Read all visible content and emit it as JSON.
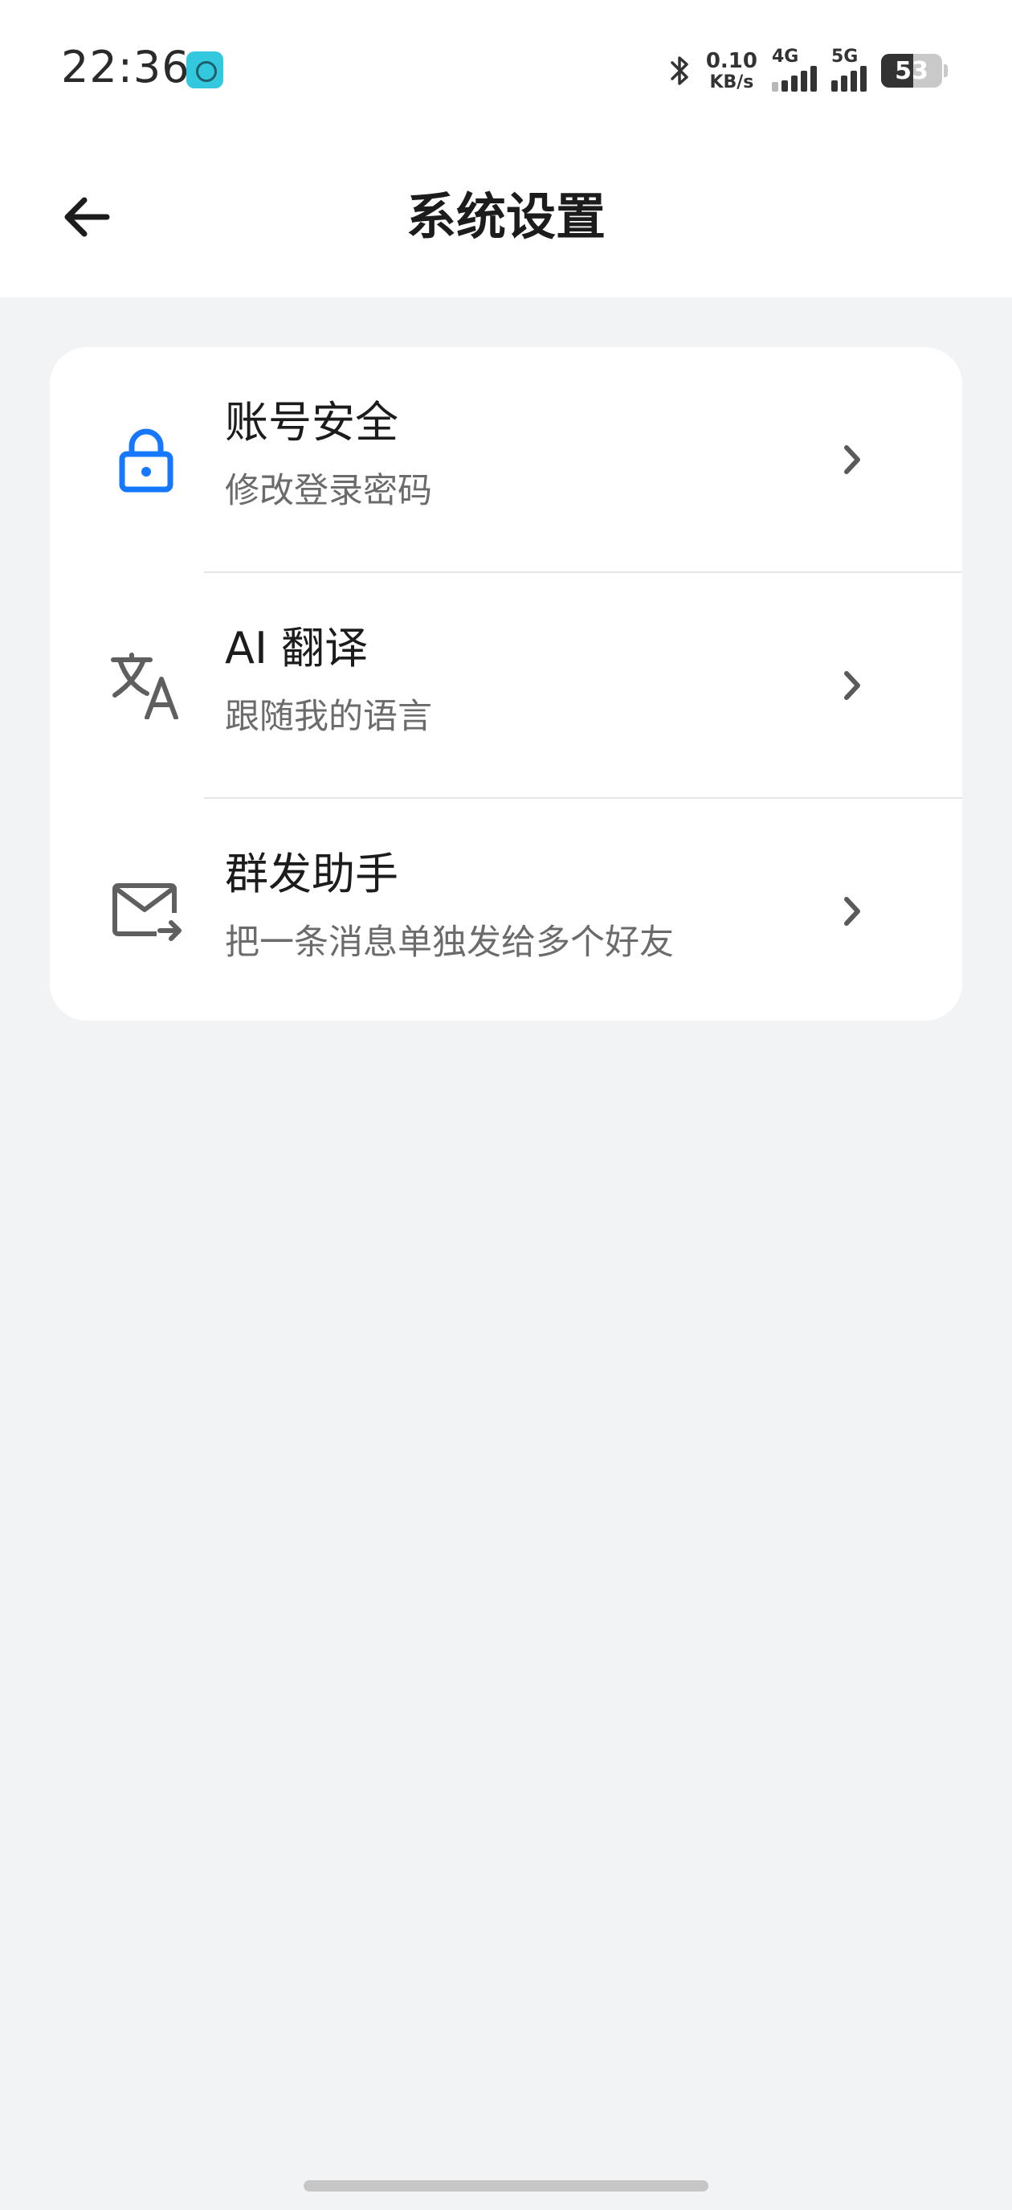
{
  "status_bar": {
    "time": "22:36",
    "net_speed_value": "0.10",
    "net_speed_unit": "KB/s",
    "sim1_label": "4G",
    "sim2_label": "5G",
    "battery_level": "53"
  },
  "header": {
    "title": "系统设置"
  },
  "settings": {
    "items": [
      {
        "title": "账号安全",
        "subtitle": "修改登录密码",
        "icon": "lock-icon",
        "icon_color": "#1677ff"
      },
      {
        "title": "AI 翻译",
        "subtitle": "跟随我的语言",
        "icon": "translate-icon",
        "icon_color": "#5f5f5f"
      },
      {
        "title": "群发助手",
        "subtitle": "把一条消息单独发给多个好友",
        "icon": "mail-forward-icon",
        "icon_color": "#5f5f5f"
      }
    ]
  },
  "colors": {
    "background": "#f2f3f5",
    "card": "#ffffff",
    "accent": "#1677ff"
  }
}
